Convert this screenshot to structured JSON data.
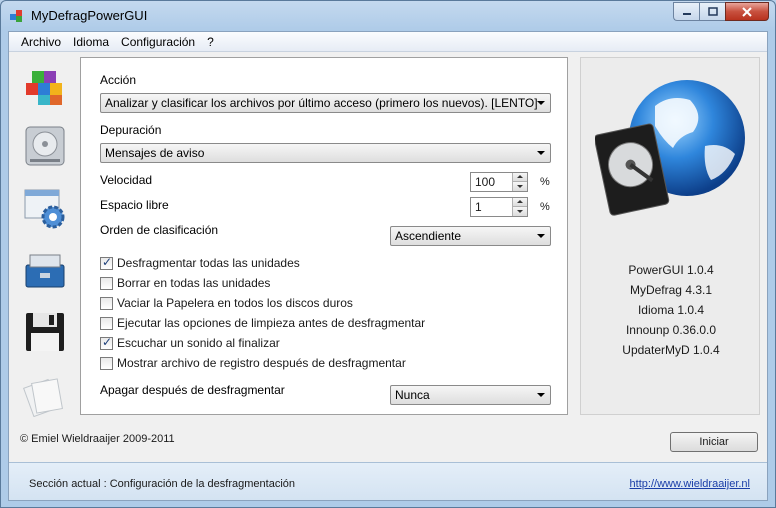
{
  "window": {
    "title": "MyDefragPowerGUI"
  },
  "menu": {
    "items": [
      "Archivo",
      "Idioma",
      "Configuración",
      "?"
    ]
  },
  "sidebar": {
    "items": [
      {
        "name": "defrag-icon"
      },
      {
        "name": "drive-icon"
      },
      {
        "name": "settings-icon"
      },
      {
        "name": "toolbox-icon"
      },
      {
        "name": "floppy-disk-icon"
      },
      {
        "name": "documents-icon"
      }
    ]
  },
  "form": {
    "accion_label": "Acción",
    "accion_value": "Analizar y clasificar los archivos por último acceso (primero los nuevos). [LENTO]",
    "depuracion_label": "Depuración",
    "depuracion_value": "Mensajes de aviso",
    "velocidad_label": "Velocidad",
    "velocidad_value": "100",
    "espacio_label": "Espacio libre",
    "espacio_value": "1",
    "percent": "%",
    "orden_label": "Orden de clasificación",
    "orden_value": "Ascendiente",
    "apagar_label": "Apagar después de desfragmentar",
    "apagar_value": "Nunca",
    "checkboxes": [
      {
        "label": "Desfragmentar todas las unidades",
        "checked": true
      },
      {
        "label": "Borrar en todas las unidades",
        "checked": false
      },
      {
        "label": "Vaciar la Papelera en todos los discos duros",
        "checked": false
      },
      {
        "label": "Ejecutar las opciones de limpieza antes de desfragmentar",
        "checked": false
      },
      {
        "label": "Escuchar un sonido al finalizar",
        "checked": true
      },
      {
        "label": "Mostrar archivo de registro después de desfragmentar",
        "checked": false
      }
    ]
  },
  "info": {
    "versions": [
      "PowerGUI 1.0.4",
      "MyDefrag 4.3.1",
      "Idioma 1.0.4",
      "Innounp 0.36.0.0",
      "UpdaterMyD 1.0.4"
    ]
  },
  "footer": {
    "copyright": "© Emiel Wieldraaijer 2009-2011",
    "start_button": "Iniciar"
  },
  "status": {
    "text": "Sección actual : Configuración de la desfragmentación",
    "link": "http://www.wieldraaijer.nl"
  }
}
